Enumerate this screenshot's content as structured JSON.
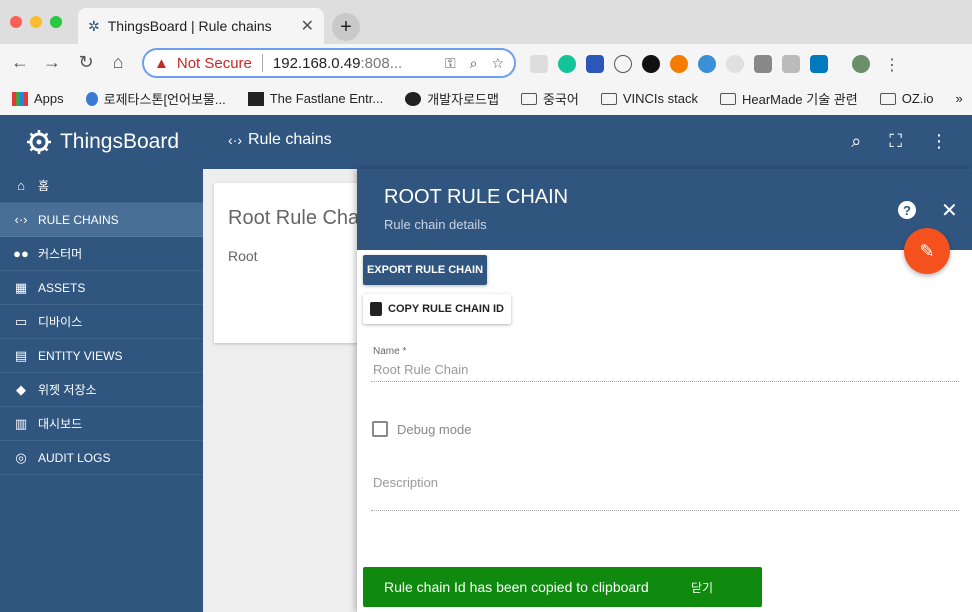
{
  "browser": {
    "tab_title": "ThingsBoard | Rule chains",
    "tab_close": "✕",
    "new_tab": "+",
    "not_secure": "Not Secure",
    "url_host": "192.168.0.49",
    "url_rest": ":808...",
    "bookmarks": [
      "Apps",
      "로제타스톤[언어보물...",
      "The Fastlane Entr...",
      "개발자로드맵",
      "중국어",
      "VINCIs stack",
      "HearMade 기술 관련",
      "OZ.io"
    ],
    "more": "»"
  },
  "app": {
    "brand": "ThingsBoard",
    "breadcrumb": "Rule chains",
    "sidebar": [
      {
        "label": "홈",
        "icon": "home-icon"
      },
      {
        "label": "RULE CHAINS",
        "icon": "rule-chains-icon"
      },
      {
        "label": "커스터머",
        "icon": "customers-icon"
      },
      {
        "label": "ASSETS",
        "icon": "assets-icon"
      },
      {
        "label": "디바이스",
        "icon": "devices-icon"
      },
      {
        "label": "ENTITY VIEWS",
        "icon": "entity-views-icon"
      },
      {
        "label": "위젯 저장소",
        "icon": "widgets-icon"
      },
      {
        "label": "대시보드",
        "icon": "dashboards-icon"
      },
      {
        "label": "AUDIT LOGS",
        "icon": "audit-logs-icon"
      }
    ],
    "card": {
      "title": "Root Rule Chain",
      "subtitle": "Root"
    }
  },
  "panel": {
    "title": "ROOT RULE CHAIN",
    "subtitle": "Rule chain details",
    "export_label": "EXPORT RULE CHAIN",
    "copy_label": "COPY RULE CHAIN ID",
    "name_label": "Name *",
    "name_value": "Root Rule Chain",
    "debug_label": "Debug mode",
    "description_placeholder": "Description"
  },
  "toast": {
    "message": "Rule chain Id has been copied to clipboard",
    "close_label": "닫기"
  },
  "colors": {
    "primary": "#305680",
    "accent": "#f4511e",
    "toast": "#0f8a0f"
  }
}
